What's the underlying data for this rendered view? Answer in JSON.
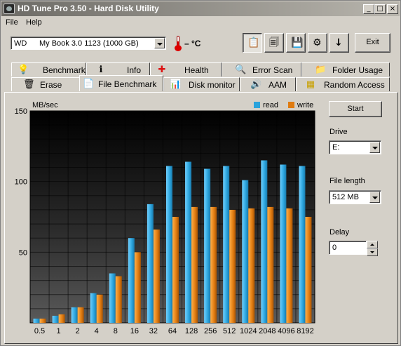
{
  "window": {
    "title": "HD Tune Pro 3.50 - Hard Disk Utility",
    "controls": {
      "minimize": "_",
      "maximize": "□",
      "close": "×"
    }
  },
  "menu": {
    "file": "File",
    "help": "Help"
  },
  "toolbar": {
    "drive_brand": "WD",
    "drive_name": "My Book 3.0 1123 (1000 GB)",
    "temperature": "– °C",
    "exit_label": "Exit",
    "icons": [
      "copy-text-icon",
      "copy-screenshot-icon",
      "save-icon",
      "options-icon",
      "download-icon"
    ]
  },
  "tabs_row1": [
    {
      "label": "Benchmark",
      "icon": "lightbulb-icon"
    },
    {
      "label": "Info",
      "icon": "info-icon"
    },
    {
      "label": "Health",
      "icon": "health-cross-icon"
    },
    {
      "label": "Error Scan",
      "icon": "magnifier-icon"
    },
    {
      "label": "Folder Usage",
      "icon": "folder-icon"
    }
  ],
  "tabs_row2": [
    {
      "label": "Erase",
      "icon": "trash-icon"
    },
    {
      "label": "File Benchmark",
      "icon": "file-benchmark-icon",
      "active": true
    },
    {
      "label": "Disk monitor",
      "icon": "disk-monitor-icon"
    },
    {
      "label": "AAM",
      "icon": "speaker-icon"
    },
    {
      "label": "Random Access",
      "icon": "random-access-icon"
    }
  ],
  "side": {
    "start_label": "Start",
    "drive_label": "Drive",
    "drive_value": "E:",
    "file_length_label": "File length",
    "file_length_value": "512 MB",
    "delay_label": "Delay",
    "delay_value": "0"
  },
  "chart_data": {
    "type": "bar",
    "ylabel": "MB/sec",
    "ylim": [
      0,
      150
    ],
    "yticks": [
      50,
      100,
      150
    ],
    "categories": [
      "0.5",
      "1",
      "2",
      "4",
      "8",
      "16",
      "32",
      "64",
      "128",
      "256",
      "512",
      "1024",
      "2048",
      "4096",
      "8192"
    ],
    "series": [
      {
        "name": "read",
        "color": "#2aa3dc",
        "values": [
          3,
          5,
          11,
          21,
          35,
          60,
          84,
          111,
          114,
          109,
          111,
          101,
          115,
          112,
          111
        ]
      },
      {
        "name": "write",
        "color": "#e07b10",
        "values": [
          3,
          6,
          11,
          20,
          33,
          50,
          66,
          75,
          82,
          82,
          80,
          81,
          82,
          81,
          75
        ]
      }
    ],
    "grid": true,
    "legend_position": "top-right"
  }
}
